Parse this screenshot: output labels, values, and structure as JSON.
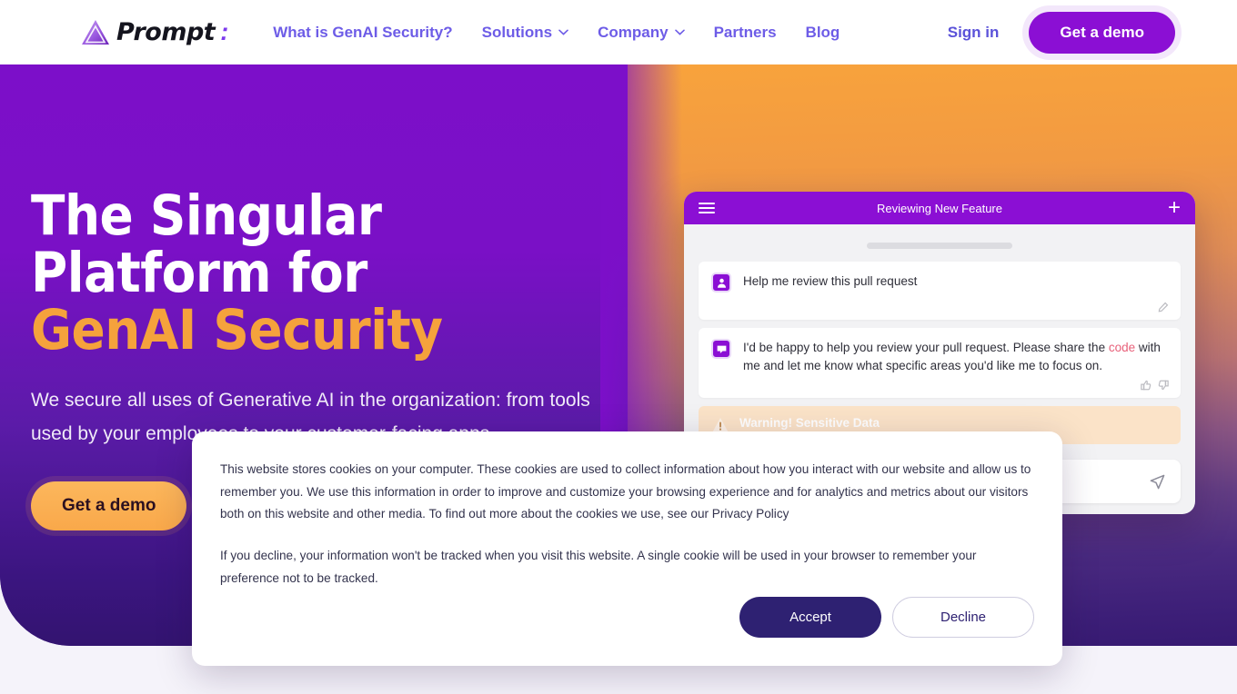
{
  "header": {
    "logo_text": "Prompt",
    "logo_colon": ":",
    "nav": [
      {
        "label": "What is GenAI Security?",
        "has_caret": false
      },
      {
        "label": "Solutions",
        "has_caret": true
      },
      {
        "label": "Company",
        "has_caret": true
      },
      {
        "label": "Partners",
        "has_caret": false
      },
      {
        "label": "Blog",
        "has_caret": false
      }
    ],
    "signin_label": "Sign in",
    "demo_label": "Get a demo"
  },
  "hero": {
    "heading_line1": "The Singular Platform for",
    "heading_line2": "GenAI Security",
    "subtext": "We secure all uses of Generative AI in the organization: from tools used by your employees to your customer-facing apps",
    "cta_label": "Get a demo"
  },
  "chat": {
    "title": "Reviewing New Feature",
    "user_message": "Help me review this pull request",
    "bot_message_pre": "I'd be happy to help you review your pull request. Please share the ",
    "bot_message_code": "code",
    "bot_message_post": " with me and let me know what specific areas you'd like me to focus on.",
    "warning_title": "Warning! Sensitive Data"
  },
  "cookie": {
    "paragraph1": "This website stores cookies on your computer. These cookies are used to collect information about how you interact with our website and allow us to remember you. We use this information in order to improve and customize your browsing experience and for analytics and metrics about our visitors both on this website and other media. To find out more about the cookies we use, see our Privacy Policy",
    "paragraph2": "If you decline, your information won't be tracked when you visit this website. A single cookie will be used in your browser to remember your preference not to be tracked.",
    "accept_label": "Accept",
    "decline_label": "Decline"
  },
  "colors": {
    "brand_purple": "#8b0fd4",
    "nav_purple": "#6d5ce7",
    "accent_orange": "#f5a23c",
    "accept_navy": "#2e2172",
    "code_red": "#e8607a"
  }
}
